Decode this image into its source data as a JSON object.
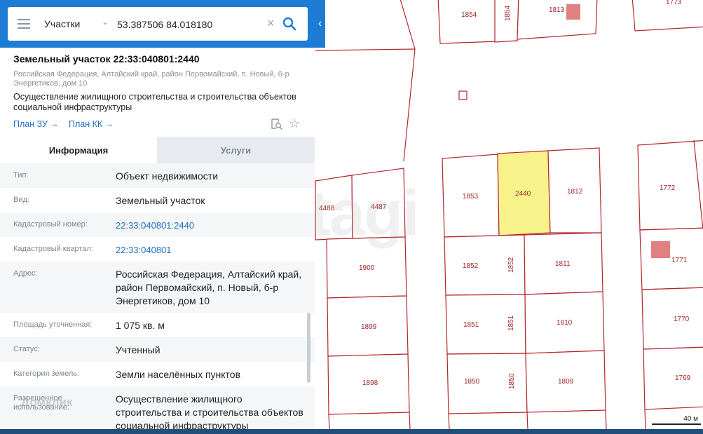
{
  "search": {
    "layer": "Участки",
    "query": "53.387506 84.018180"
  },
  "parcel": {
    "title": "Земельный участок 22:33:040801:2440",
    "address": "Российская Федерация, Алтайский край, район Первомайский, п. Новый, б-р Энергетиков, дом 10",
    "purpose": "Осуществление жилищного строительства и строительства объектов социальной инфраструктуры",
    "plan_zu": "План ЗУ →",
    "plan_kk": "План КК →"
  },
  "tabs": {
    "info": "Информация",
    "services": "Услуги"
  },
  "fields": [
    {
      "key": "Тип:",
      "value": "Объект недвижимости"
    },
    {
      "key": "Вид:",
      "value": "Земельный участок"
    },
    {
      "key": "Кадастровый номер:",
      "value": "22:33:040801:2440"
    },
    {
      "key": "Кадастровый квартал:",
      "value": "22:33:040801"
    },
    {
      "key": "Адрес:",
      "value": "Российская Федерация, Алтайский край, район Первомайский, п. Новый, б-р Энергетиков, дом 10"
    },
    {
      "key": "Площадь уточненная:",
      "value": "1 075 кв. м"
    },
    {
      "key": "Статус:",
      "value": "Учтенный"
    },
    {
      "key": "Категория земель:",
      "value": "Земли населённых пунктов"
    },
    {
      "key": "Разрешенное использование:",
      "value": "Осуществление жилищного строительства и строительства объектов социальной инфраструктуры"
    }
  ],
  "map": {
    "labels": [
      "1854",
      "1854",
      "1813",
      "1773",
      "2440",
      "1853",
      "1812",
      "1772",
      "4488",
      "4487",
      "1900",
      "1852",
      "1852",
      "1811",
      "1771",
      "1899",
      "1851",
      "1851",
      "1810",
      "1770",
      "1898",
      "1850",
      "1850",
      "1809",
      "1769"
    ],
    "scale": "40 м",
    "watermark": "etagi"
  },
  "watermark_text": "Домклик",
  "colors": {
    "accent": "#1f7cd4",
    "parcel_border": "#b3262c",
    "selected_fill": "#f7f38a",
    "building": "#e08080",
    "link": "#1f6fc4"
  }
}
